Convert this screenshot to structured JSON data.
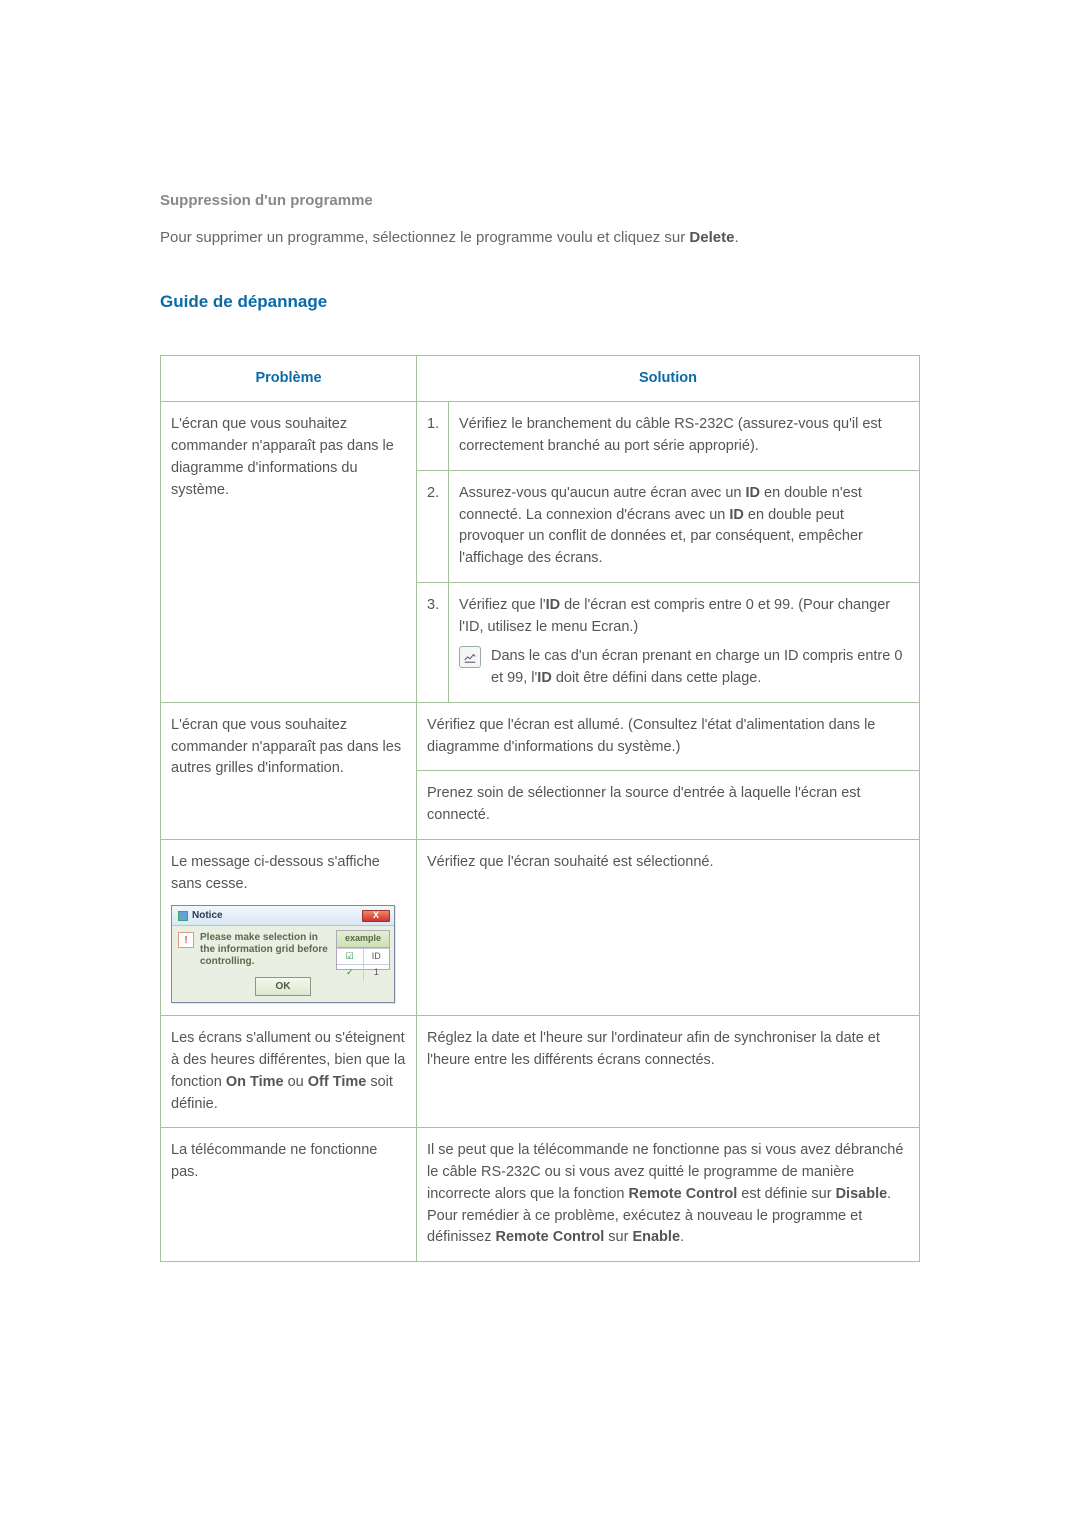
{
  "section_delete": {
    "title": "Suppression d'un programme",
    "text_before": "Pour supprimer un programme, sélectionnez le programme voulu et cliquez sur ",
    "text_bold": "Delete",
    "text_after": "."
  },
  "section_guide": {
    "title": "Guide de dépannage"
  },
  "table": {
    "head_problem": "Problème",
    "head_solution": "Solution",
    "rows": [
      {
        "problem": "L'écran que vous souhaitez commander n'apparaît pas dans le diagramme d'informations du système.",
        "solutions": [
          {
            "num": "1.",
            "text": "Vérifiez le branchement du câble RS-232C (assurez-vous qu'il est correctement branché au port série approprié)."
          },
          {
            "num": "2.",
            "parts": [
              {
                "t": "Assurez-vous qu'aucun autre écran avec un "
              },
              {
                "b": "ID"
              },
              {
                "t": " en double n'est connecté. La connexion d'écrans avec un "
              },
              {
                "b": "ID"
              },
              {
                "t": " en double peut provoquer un conflit de données et, par conséquent, empêcher l'affichage des écrans."
              }
            ]
          },
          {
            "num": "3.",
            "parts": [
              {
                "t": "Vérifiez que l'"
              },
              {
                "b": "ID"
              },
              {
                "t": " de l'écran est compris entre 0 et 99. (Pour changer l'ID, utilisez le menu Ecran.)"
              }
            ],
            "note_parts": [
              {
                "t": "Dans le cas d'un écran prenant en charge un ID compris entre 0 et 99, l'"
              },
              {
                "b": "ID"
              },
              {
                "t": " doit être défini dans cette plage."
              }
            ]
          }
        ]
      },
      {
        "problem": "L'écran que vous souhaitez commander n'apparaît pas dans les autres grilles d'information.",
        "solutions": [
          {
            "text": "Vérifiez que l'écran est allumé. (Consultez l'état d'alimentation dans le diagramme d'informations du système.)"
          },
          {
            "text": "Prenez soin de sélectionner la source d'entrée à laquelle l'écran est connecté."
          }
        ]
      },
      {
        "problem_text": "Le message ci-dessous s'affiche sans cesse.",
        "dialog": {
          "title": "Notice",
          "message": "Please make selection in the information grid before controlling.",
          "example_label": "example",
          "ex_id_label": "ID",
          "ex_val": "1",
          "ok": "OK",
          "close": "X"
        },
        "solutions": [
          {
            "text": "Vérifiez que l'écran souhaité est sélectionné."
          }
        ]
      },
      {
        "problem_parts": [
          {
            "t": "Les écrans s'allument ou s'éteignent à des heures différentes, bien que la fonction "
          },
          {
            "b": "On Time"
          },
          {
            "t": " ou "
          },
          {
            "b": "Off Time"
          },
          {
            "t": " soit définie."
          }
        ],
        "solutions": [
          {
            "text": "Réglez la date et l'heure sur l'ordinateur afin de synchroniser la date et l'heure entre les différents écrans connectés."
          }
        ]
      },
      {
        "problem": "La télécommande ne fonctionne pas.",
        "solutions": [
          {
            "parts": [
              {
                "t": "Il se peut que la télécommande ne fonctionne pas si vous avez débranché le câble RS-232C ou si vous avez quitté le programme de manière incorrecte alors que la fonction "
              },
              {
                "b": "Remote Control"
              },
              {
                "t": " est définie sur "
              },
              {
                "b": "Disable"
              },
              {
                "t": ". Pour remédier à ce problème, exécutez à nouveau le programme et définissez "
              },
              {
                "b": "Remote Control"
              },
              {
                "t": " sur "
              },
              {
                "b": "Enable"
              },
              {
                "t": "."
              }
            ]
          }
        ]
      }
    ]
  }
}
